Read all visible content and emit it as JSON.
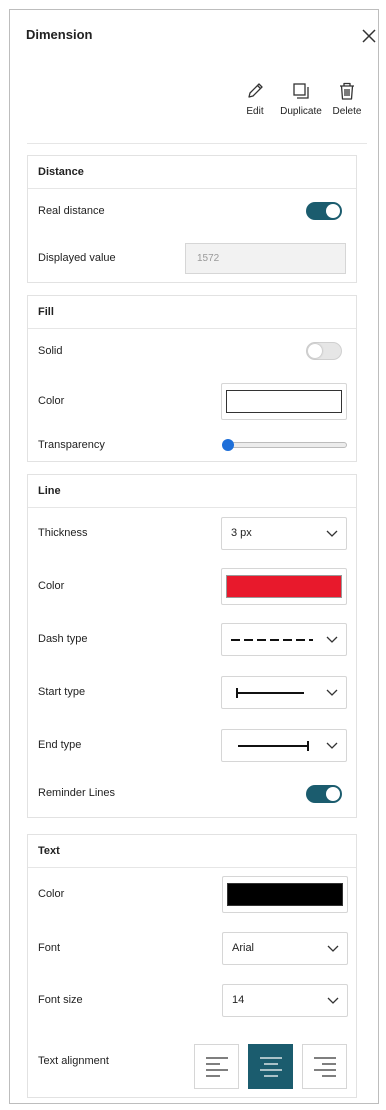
{
  "panel": {
    "title": "Dimension"
  },
  "actions": {
    "edit": "Edit",
    "duplicate": "Duplicate",
    "delete": "Delete"
  },
  "distance": {
    "header": "Distance",
    "real_distance_label": "Real distance",
    "real_distance_on": true,
    "displayed_value_label": "Displayed value",
    "displayed_value": "1572"
  },
  "fill": {
    "header": "Fill",
    "solid_label": "Solid",
    "solid_on": false,
    "color_label": "Color",
    "color": "#ffffff",
    "transparency_label": "Transparency",
    "transparency": 0
  },
  "line": {
    "header": "Line",
    "thickness_label": "Thickness",
    "thickness_value": "3 px",
    "color_label": "Color",
    "color": "#e8192c",
    "dash_type_label": "Dash type",
    "dash_type": "dashed",
    "start_type_label": "Start type",
    "start_type": "bar-start",
    "end_type_label": "End type",
    "end_type": "bar-end",
    "reminder_lines_label": "Reminder Lines",
    "reminder_lines_on": true
  },
  "text": {
    "header": "Text",
    "color_label": "Color",
    "color": "#000000",
    "font_label": "Font",
    "font_value": "Arial",
    "font_size_label": "Font size",
    "font_size_value": "14",
    "alignment_label": "Text alignment",
    "alignment": "center"
  },
  "colors": {
    "accent": "#1b5c6e",
    "slider_thumb": "#1e6fd9"
  },
  "icons": [
    "close-icon",
    "edit-icon",
    "duplicate-icon",
    "delete-icon",
    "chevron-down-icon",
    "align-left-icon",
    "align-center-icon",
    "align-right-icon"
  ]
}
